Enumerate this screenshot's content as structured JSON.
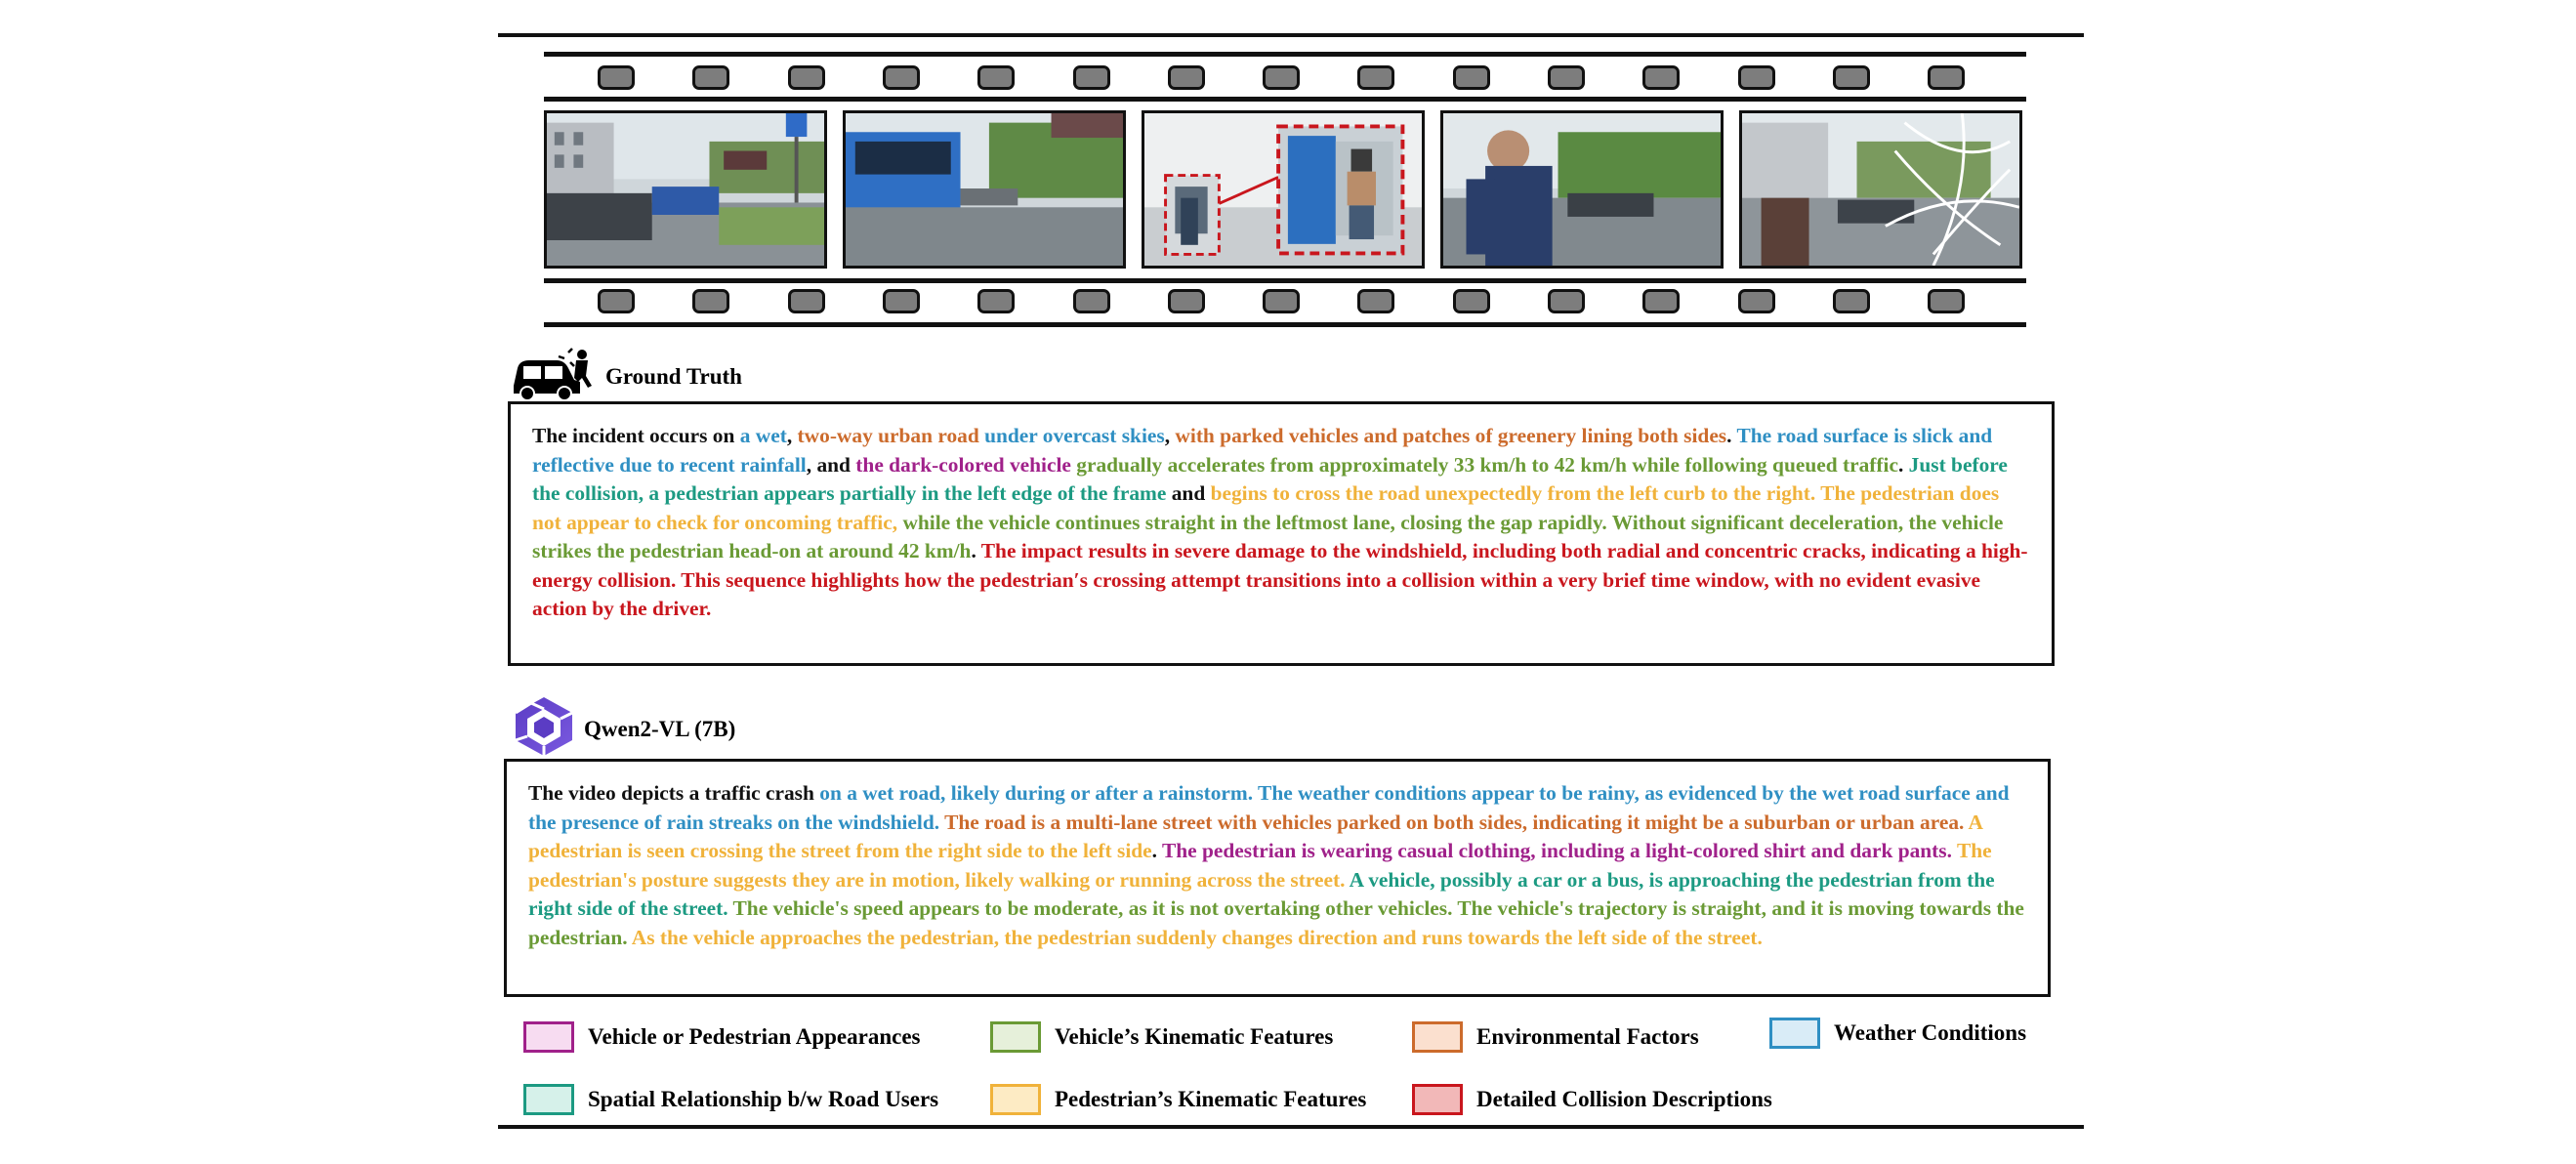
{
  "film_frames": [
    {
      "alt": "dashcam frame 1 - wet urban road with parked cars and buses"
    },
    {
      "alt": "dashcam frame 2 - blue bus on the road ahead"
    },
    {
      "alt": "dashcam frame 3 - pedestrian highlighted in dashed red boxes with zoom inset"
    },
    {
      "alt": "dashcam frame 4 - pedestrian crossing in front of vehicle"
    },
    {
      "alt": "dashcam frame 5 - cracked windshield after impact"
    }
  ],
  "ground_truth": {
    "title": "Ground Truth",
    "segments": [
      {
        "text": "The incident occurs on ",
        "cat": "black"
      },
      {
        "text": "a wet",
        "cat": "weather"
      },
      {
        "text": ", ",
        "cat": "black"
      },
      {
        "text": "two-way urban road",
        "cat": "env"
      },
      {
        "text": " ",
        "cat": "black"
      },
      {
        "text": "under overcast skies",
        "cat": "weather"
      },
      {
        "text": ", ",
        "cat": "black"
      },
      {
        "text": "with parked vehicles and patches of greenery lining both sides",
        "cat": "env"
      },
      {
        "text": ". ",
        "cat": "black"
      },
      {
        "text": "The road surface is slick and reflective due to recent rainfall",
        "cat": "weather"
      },
      {
        "text": ", and ",
        "cat": "black"
      },
      {
        "text": "the dark-colored vehicle",
        "cat": "vehicle"
      },
      {
        "text": " ",
        "cat": "black"
      },
      {
        "text": "gradually accelerates from approximately 33 km/h to 42 km/h while following queued traffic",
        "cat": "kin"
      },
      {
        "text": ". ",
        "cat": "black"
      },
      {
        "text": "Just before the collision, a pedestrian appears partially in the left edge of the frame",
        "cat": "spatial"
      },
      {
        "text": " and ",
        "cat": "black"
      },
      {
        "text": "begins to cross the road unexpectedly from the left curb to the right. The pedestrian does not appear to check for oncoming traffic,",
        "cat": "ped"
      },
      {
        "text": " ",
        "cat": "black"
      },
      {
        "text": "while the vehicle continues straight in the leftmost lane, closing the gap rapidly. Without significant deceleration, the vehicle strikes the pedestrian head-on at around 42 km/h",
        "cat": "kin"
      },
      {
        "text": ". ",
        "cat": "black"
      },
      {
        "text": "The impact results in severe damage to the windshield, including both radial and concentric cracks, indicating a high-energy collision. This sequence highlights how the pedestrian′s crossing attempt transitions into a collision within a very brief time window, with no evident evasive action by the driver.",
        "cat": "collision"
      }
    ]
  },
  "model_output": {
    "title": "Qwen2-VL (7B)",
    "segments": [
      {
        "text": "The video depicts a traffic crash ",
        "cat": "black"
      },
      {
        "text": "on a wet road, likely during or after a rainstorm. The weather conditions appear to be rainy, as evidenced by the wet road surface and the presence of rain streaks on the windshield.",
        "cat": "weather"
      },
      {
        "text": " ",
        "cat": "black"
      },
      {
        "text": "The road is a multi-lane street with vehicles parked on both sides, indicating it might be a suburban or urban area.",
        "cat": "env"
      },
      {
        "text": " ",
        "cat": "black"
      },
      {
        "text": "A pedestrian is seen crossing the street from the right side to the left side",
        "cat": "ped"
      },
      {
        "text": ". ",
        "cat": "black"
      },
      {
        "text": "The pedestrian is wearing casual clothing, including a light-colored shirt and dark pants.",
        "cat": "vehicle"
      },
      {
        "text": " ",
        "cat": "black"
      },
      {
        "text": "The pedestrian's posture suggests they are in motion, likely walking or running across the street.",
        "cat": "ped"
      },
      {
        "text": " ",
        "cat": "black"
      },
      {
        "text": "A vehicle, possibly a car or a bus, is approaching the pedestrian from the right side of the street.",
        "cat": "spatial"
      },
      {
        "text": " ",
        "cat": "black"
      },
      {
        "text": "The vehicle's speed appears to be moderate, as it is not overtaking other vehicles. The vehicle's trajectory is straight, and it is moving towards the pedestrian.",
        "cat": "kin"
      },
      {
        "text": " ",
        "cat": "black"
      },
      {
        "text": "As the vehicle approaches the pedestrian, the pedestrian suddenly changes direction and runs towards the left side of the street.",
        "cat": "ped"
      }
    ]
  },
  "legend": [
    {
      "label": "Vehicle or Pedestrian Appearances",
      "border": "#a0218a",
      "fill": "#f7dcf1"
    },
    {
      "label": "Vehicle’s Kinematic Features",
      "border": "#6a9a35",
      "fill": "#e6f0da"
    },
    {
      "label": "Environmental Factors",
      "border": "#cc6b2c",
      "fill": "#fbe0cf"
    },
    {
      "label": "Weather Conditions",
      "border": "#2f8fc3",
      "fill": "#d9ecf7"
    },
    {
      "label": "Spatial Relationship b/w Road Users",
      "border": "#1c9a82",
      "fill": "#d6f1ea"
    },
    {
      "label": "Pedestrian’s Kinematic Features",
      "border": "#f0b23a",
      "fill": "#fdebc4"
    },
    {
      "label": "Detailed Collision Descriptions",
      "border": "#c9161d",
      "fill": "#f2b8b8"
    }
  ],
  "colors": {
    "black": "#111111",
    "weather": "#2f8fc3",
    "env": "#cc6b2c",
    "vehicle": "#a0218a",
    "kin": "#6a9a35",
    "spatial": "#1c9a82",
    "ped": "#f0b23a",
    "collision": "#c9161d"
  },
  "icons": {
    "ground_truth": "car-crash-icon",
    "model": "qwen-logo-icon"
  }
}
